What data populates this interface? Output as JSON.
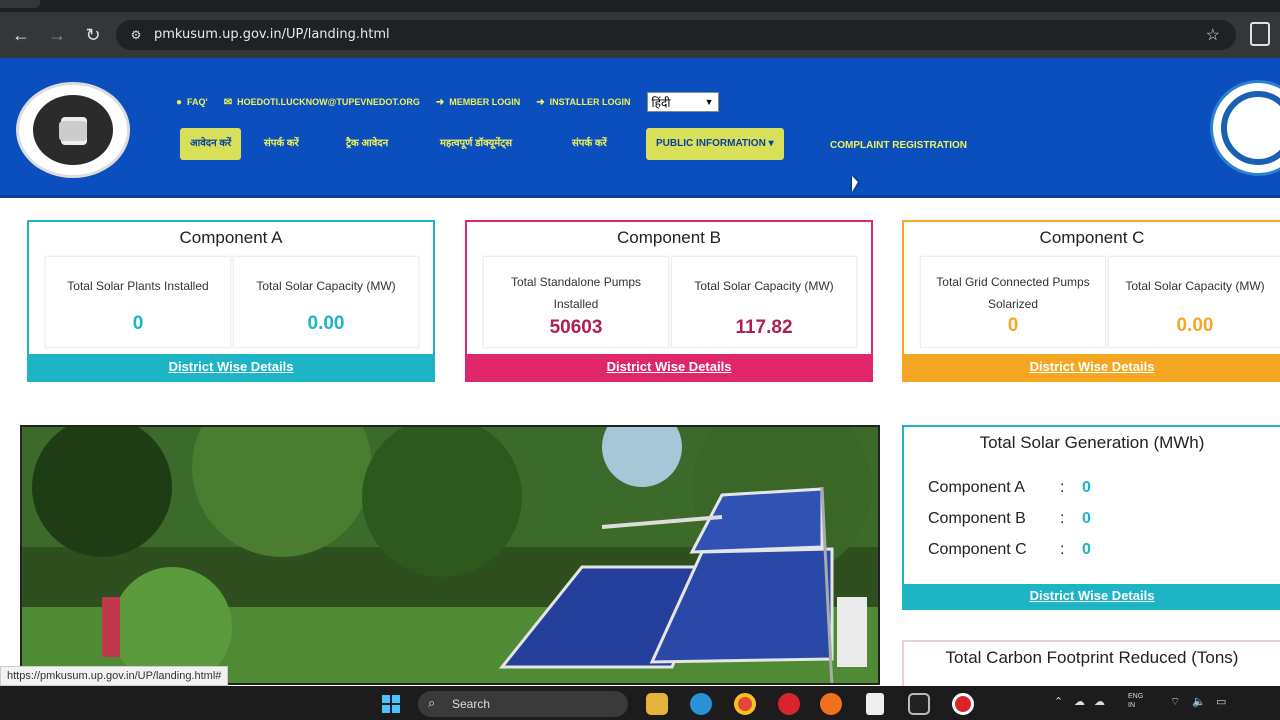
{
  "browser": {
    "url": "pmkusum.up.gov.in/UP/landing.html"
  },
  "header": {
    "top_links": [
      {
        "label": "FAQ'",
        "icon": "question-circle"
      },
      {
        "label": "HOEDOTI.LUCKNOW@TUPEVNEDOT.ORG",
        "icon": "envelope"
      },
      {
        "label": "MEMBER LOGIN",
        "icon": "login-arrow"
      },
      {
        "label": "INSTALLER LOGIN",
        "icon": "login-arrow"
      }
    ],
    "language": "हिंदी",
    "menu": [
      {
        "label": "आवेदन करें"
      },
      {
        "label": "संपर्क करें"
      },
      {
        "label": "ट्रैक आवेदन"
      },
      {
        "label": "महत्वपूर्ण डॉक्यूमेंट्स"
      },
      {
        "label": "संपर्क करें"
      },
      {
        "label": "PUBLIC INFORMATION ▾"
      },
      {
        "label": "COMPLAINT REGISTRATION"
      }
    ]
  },
  "components": [
    {
      "title": "Component A",
      "label1": "Total Solar Plants Installed",
      "value1": "0",
      "label2": "Total Solar Capacity (MW)",
      "value2": "0.00",
      "footer": "District Wise Details",
      "color": "#1db4c6"
    },
    {
      "title": "Component B",
      "label1": "Total Standalone Pumps Installed",
      "value1": "50603",
      "label2": "Total Solar Capacity (MW)",
      "value2": "117.82",
      "footer": "District Wise Details",
      "color": "#e0266b"
    },
    {
      "title": "Component C",
      "label1": "Total Grid Connected Pumps Solarized",
      "value1": "0",
      "label2": "Total Solar Capacity (MW)",
      "value2": "0.00",
      "footer": "District Wise Details",
      "color": "#f5a623"
    }
  ],
  "generation": {
    "title": "Total Solar Generation (MWh)",
    "rows": [
      {
        "label": "Component A",
        "colon": ":",
        "value": "0"
      },
      {
        "label": "Component B",
        "colon": ":",
        "value": "0"
      },
      {
        "label": "Component C",
        "colon": ":",
        "value": "0"
      }
    ],
    "footer": "District Wise Details"
  },
  "carbon": {
    "title": "Total Carbon Footprint Reduced (Tons)"
  },
  "status_url": "https://pmkusum.up.gov.in/UP/landing.html#",
  "taskbar": {
    "search_label": "Search",
    "tray_lang_1": "ENG",
    "tray_lang_2": "IN"
  }
}
